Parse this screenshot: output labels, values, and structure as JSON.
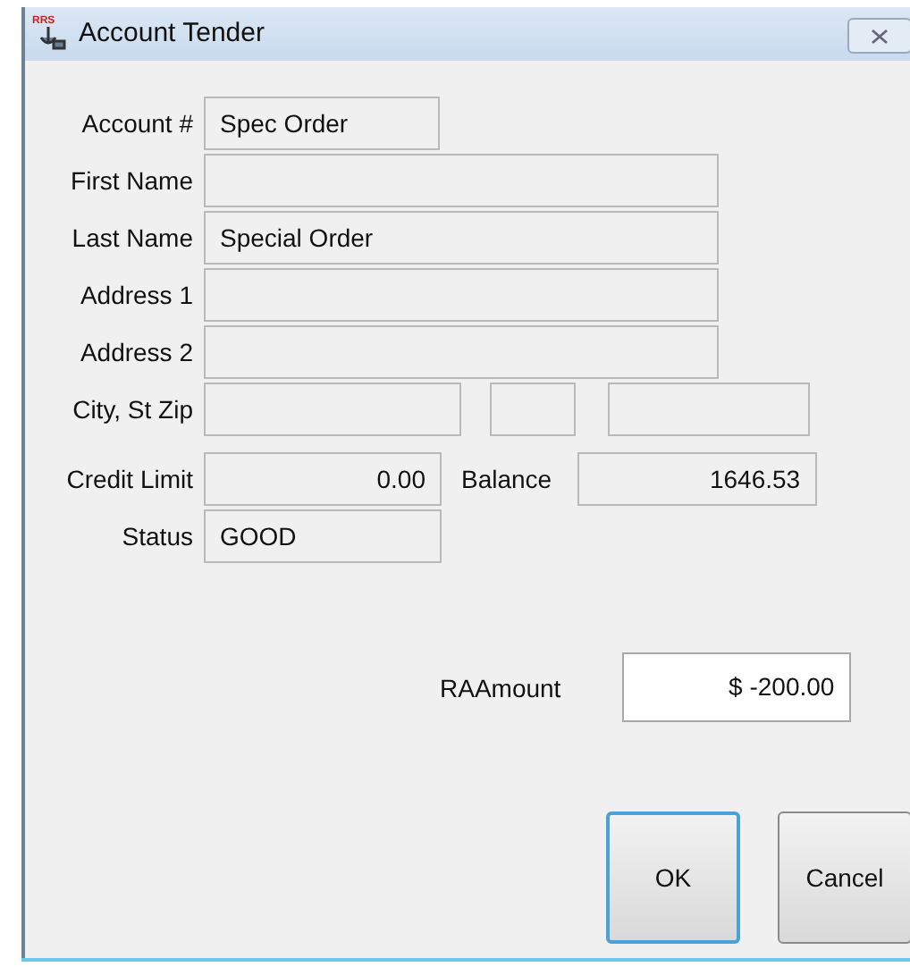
{
  "window": {
    "title": "Account Tender",
    "icon_label": "RRS"
  },
  "rows": [
    {
      "items": [
        {
          "kind": "label",
          "text": "Account #"
        },
        {
          "kind": "field",
          "value": "Spec Order"
        }
      ]
    },
    {
      "items": [
        {
          "kind": "label",
          "text": "First Name"
        },
        {
          "kind": "field"
        }
      ]
    },
    {
      "items": [
        {
          "kind": "label",
          "text": "Last Name"
        },
        {
          "kind": "field",
          "value": "Special Order"
        }
      ]
    },
    {
      "items": [
        {
          "kind": "label",
          "text": "Address 1"
        },
        {
          "kind": "field"
        }
      ]
    },
    {
      "items": [
        {
          "kind": "label",
          "text": "Address 2"
        },
        {
          "kind": "field"
        }
      ]
    },
    {
      "items": [
        {
          "kind": "label",
          "text": "City, St Zip"
        },
        {
          "kind": "field"
        },
        {
          "kind": "field"
        },
        {
          "kind": "field"
        }
      ]
    },
    {
      "items": [
        {
          "kind": "label",
          "text": "Credit Limit"
        },
        {
          "kind": "number",
          "value": "0.00"
        },
        {
          "kind": "label",
          "text": "Balance"
        },
        {
          "kind": "number",
          "value": "1646.53"
        }
      ]
    },
    {
      "items": [
        {
          "kind": "label",
          "text": "Status"
        },
        {
          "kind": "field",
          "value": "GOOD"
        }
      ]
    }
  ],
  "amount": {
    "label": "RAAmount",
    "value": "$ -200.00"
  },
  "buttons": [
    {
      "label": "OK",
      "focused": true
    },
    {
      "label": "Cancel",
      "focused": false
    }
  ]
}
